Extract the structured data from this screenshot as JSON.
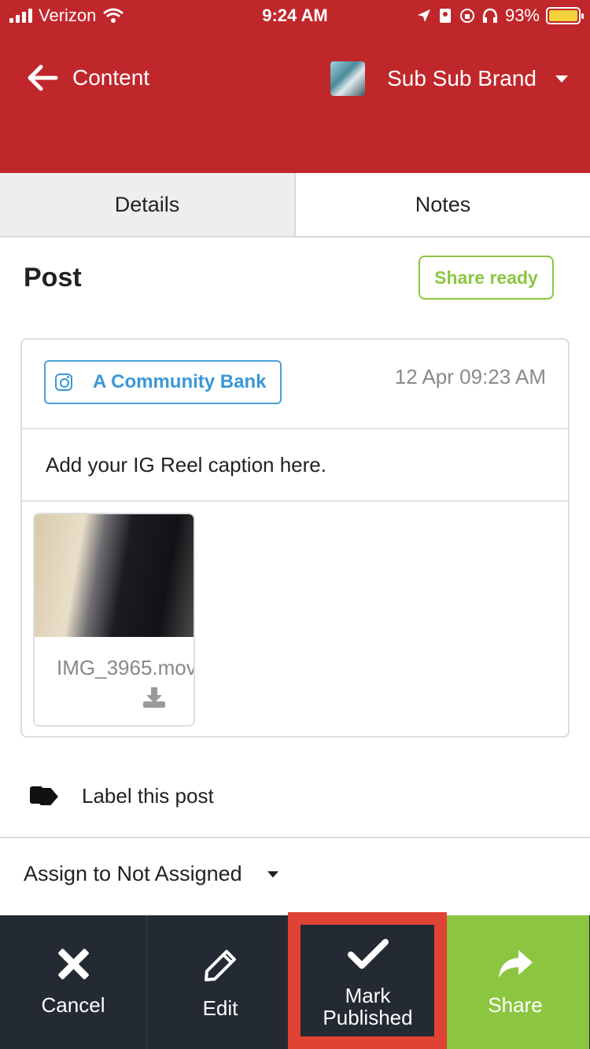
{
  "status_bar": {
    "carrier": "Verizon",
    "time": "9:24 AM",
    "battery": "93%"
  },
  "header": {
    "back_label": "Content",
    "brand_name": "Sub Sub Brand"
  },
  "tabs": [
    {
      "label": "Details"
    },
    {
      "label": "Notes"
    }
  ],
  "post": {
    "title": "Post",
    "status_button": "Share ready",
    "account": "A Community Bank",
    "timestamp": "12 Apr 09:23 AM",
    "caption": "Add your IG Reel caption here.",
    "attachment": {
      "filename": "IMG_3965.mov"
    }
  },
  "label_row": {
    "text": "Label this post"
  },
  "assign": {
    "text": "Assign to Not Assigned"
  },
  "actions": {
    "cancel": "Cancel",
    "edit": "Edit",
    "mark_published_line1": "Mark",
    "mark_published_line2": "Published",
    "share": "Share"
  },
  "colors": {
    "header_bg": "#c0272b",
    "accent_green": "#8cc641",
    "instagram_blue": "#3a97d6",
    "action_bar_bg": "#242a33",
    "highlight_red": "#e04234"
  }
}
